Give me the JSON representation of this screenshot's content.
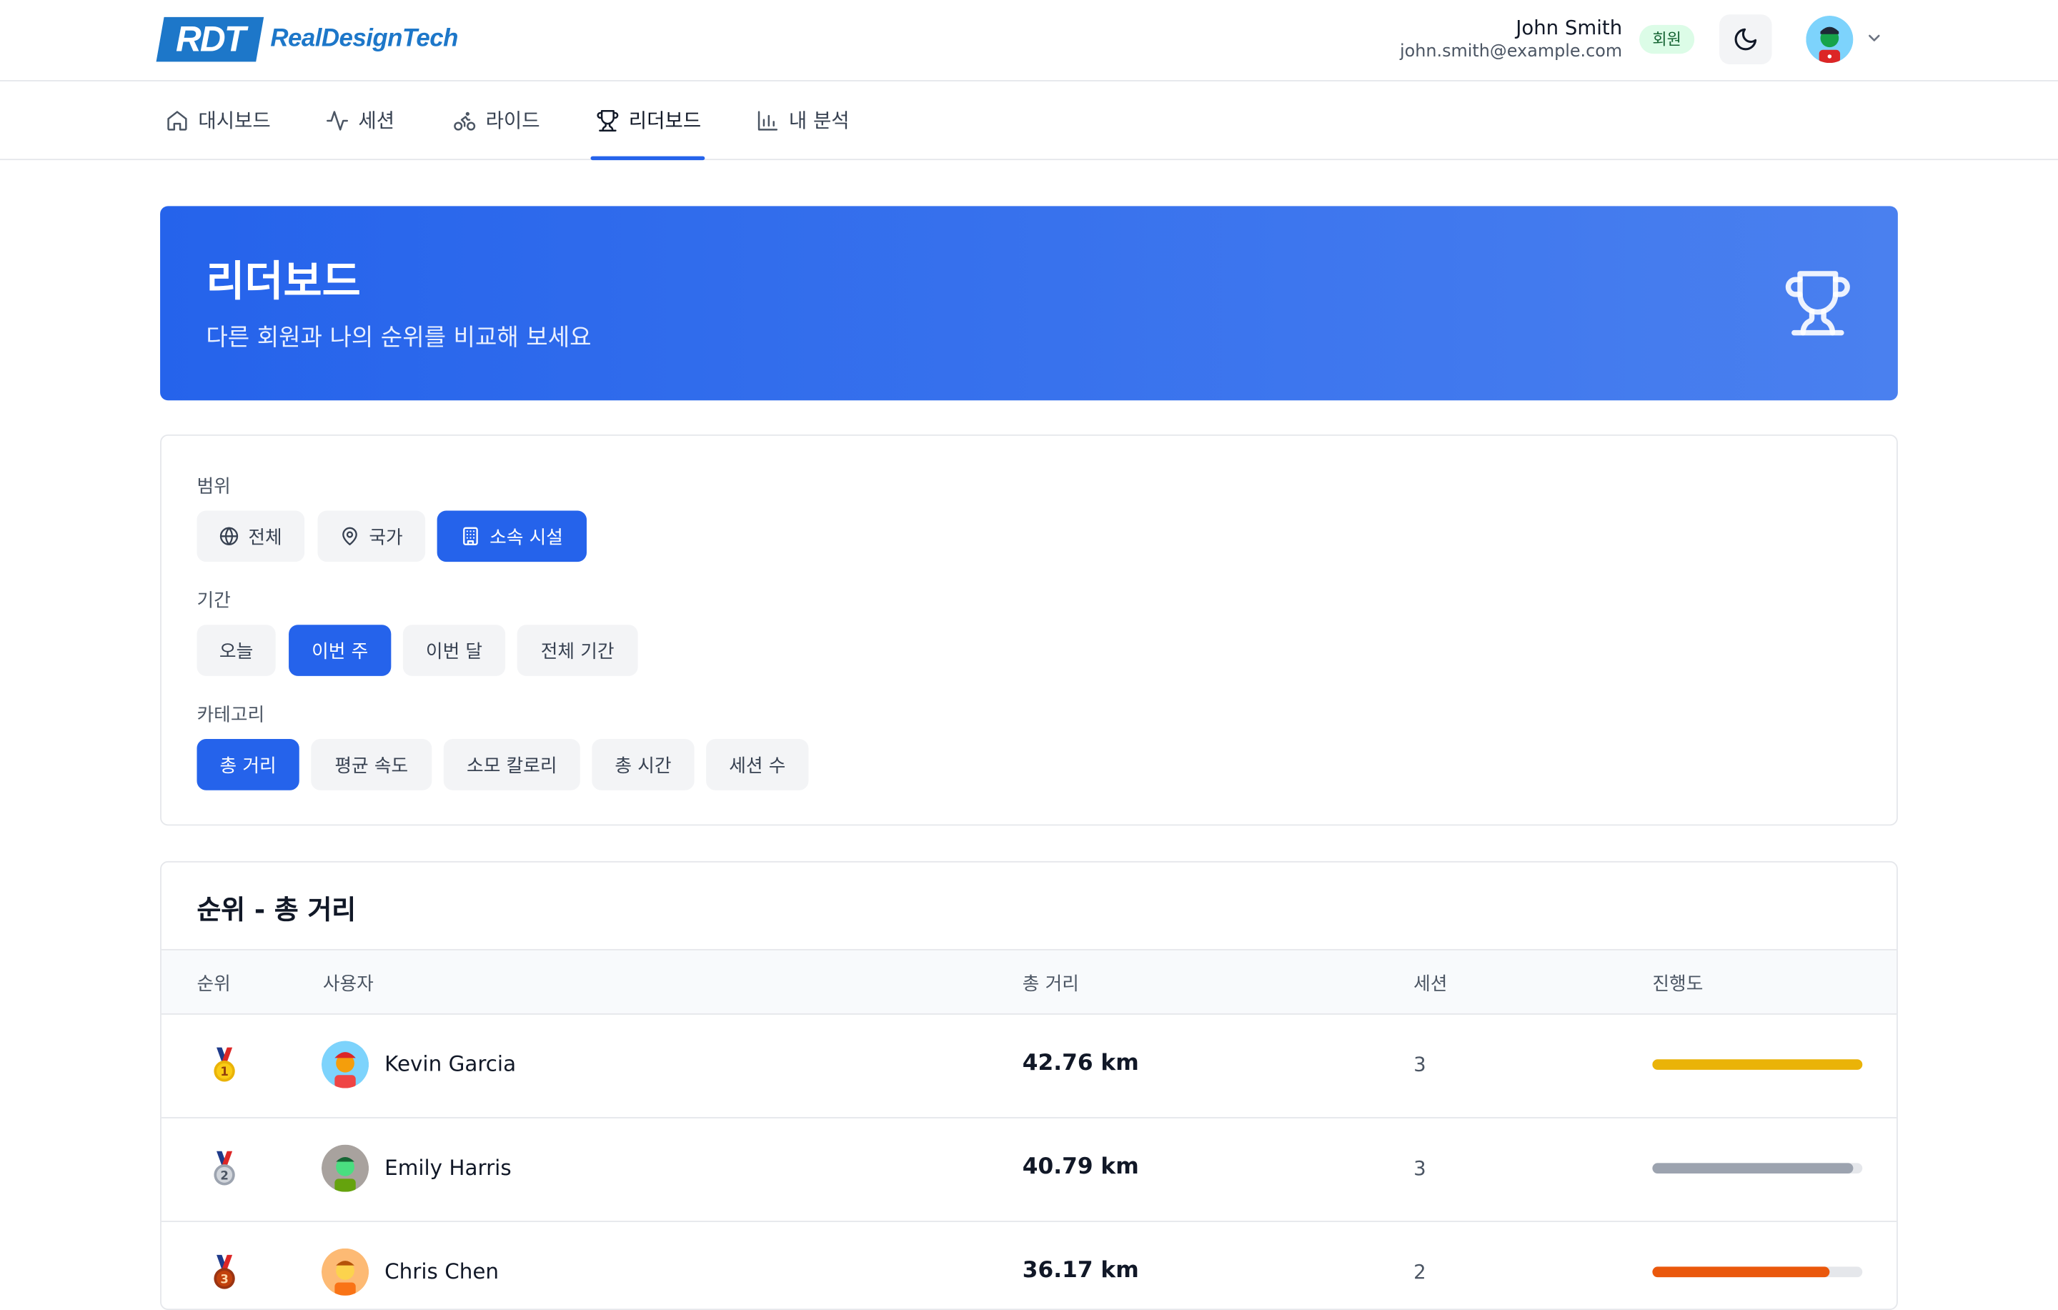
{
  "brand": {
    "mark": "RDT",
    "name": "RealDesignTech"
  },
  "user": {
    "name": "John Smith",
    "email": "john.smith@example.com",
    "role": "회원"
  },
  "nav": {
    "items": [
      {
        "label": "대시보드",
        "icon": "home-icon"
      },
      {
        "label": "세션",
        "icon": "activity-icon"
      },
      {
        "label": "라이드",
        "icon": "bike-icon"
      },
      {
        "label": "리더보드",
        "icon": "trophy-icon",
        "active": true
      },
      {
        "label": "내 분석",
        "icon": "bar-chart-icon"
      }
    ]
  },
  "hero": {
    "title": "리더보드",
    "subtitle": "다른 회원과 나의 순위를 비교해 보세요"
  },
  "filters": {
    "scope": {
      "label": "범위",
      "options": [
        "전체",
        "국가",
        "소속 시설"
      ],
      "selected": "소속 시설"
    },
    "period": {
      "label": "기간",
      "options": [
        "오늘",
        "이번 주",
        "이번 달",
        "전체 기간"
      ],
      "selected": "이번 주"
    },
    "category": {
      "label": "카테고리",
      "options": [
        "총 거리",
        "평균 속도",
        "소모 칼로리",
        "총 시간",
        "세션 수"
      ],
      "selected": "총 거리"
    }
  },
  "leaderboard": {
    "title": "순위 - 총 거리",
    "columns": [
      "순위",
      "사용자",
      "총 거리",
      "세션",
      "진행도"
    ],
    "rows": [
      {
        "rank": "1",
        "name": "Kevin Garcia",
        "distance": "42.76 km",
        "sessions": "3",
        "progress": 1.0,
        "color": "#eab308"
      },
      {
        "rank": "2",
        "name": "Emily Harris",
        "distance": "40.79 km",
        "sessions": "3",
        "progress": 0.954,
        "color": "#9ca3af"
      },
      {
        "rank": "3",
        "name": "Chris Chen",
        "distance": "36.17 km",
        "sessions": "2",
        "progress": 0.846,
        "color": "#ea580c"
      }
    ]
  },
  "colors": {
    "accent": "#2563eb",
    "brand": "#1d77c9",
    "badge_bg": "#dcfce7",
    "badge_text": "#166534"
  }
}
